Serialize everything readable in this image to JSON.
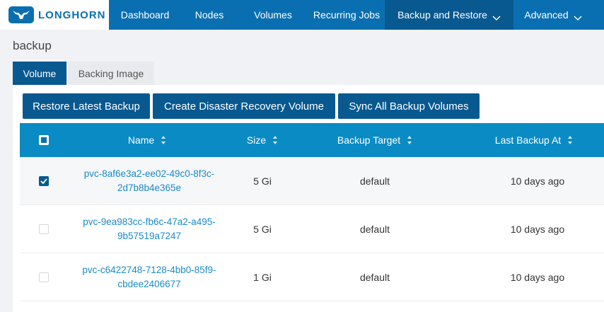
{
  "brand": {
    "name": "LONGHORN"
  },
  "nav": {
    "dashboard": "Dashboard",
    "nodes": "Nodes",
    "volumes": "Volumes",
    "recurring_jobs": "Recurring Jobs",
    "backup_restore": "Backup and Restore",
    "advanced": "Advanced"
  },
  "page": {
    "title": "backup"
  },
  "tabs": {
    "volume": "Volume",
    "backing_image": "Backing Image"
  },
  "toolbar": {
    "restore_latest": "Restore Latest Backup",
    "create_drv": "Create Disaster Recovery Volume",
    "sync_all": "Sync All Backup Volumes"
  },
  "table": {
    "headers": {
      "name": "Name",
      "size": "Size",
      "backup_target": "Backup Target",
      "last_backup": "Last Backup At"
    },
    "rows": [
      {
        "name_line1": "pvc-8af6e3a2-ee02-49c0-8f3c-",
        "name_line2": "2d7b8b4e365e",
        "size": "5 Gi",
        "target": "default",
        "last_backup": "10 days ago",
        "checked": true
      },
      {
        "name_line1": "pvc-9ea983cc-fb6c-47a2-a495-",
        "name_line2": "9b57519a7247",
        "size": "5 Gi",
        "target": "default",
        "last_backup": "10 days ago",
        "checked": false
      },
      {
        "name_line1": "pvc-c6422748-7128-4bb0-85f9-",
        "name_line2": "cbdee2406677",
        "size": "1 Gi",
        "target": "default",
        "last_backup": "10 days ago",
        "checked": false
      }
    ]
  },
  "colors": {
    "nav_bg": "#0a6fb0",
    "nav_active": "#085990",
    "table_header": "#0a8bc4",
    "link": "#1a8ac7"
  },
  "icons": {
    "logo": "longhorn-logo-icon",
    "caret": "chevron-down-icon",
    "sort": "sort-icon",
    "check": "check-icon"
  }
}
